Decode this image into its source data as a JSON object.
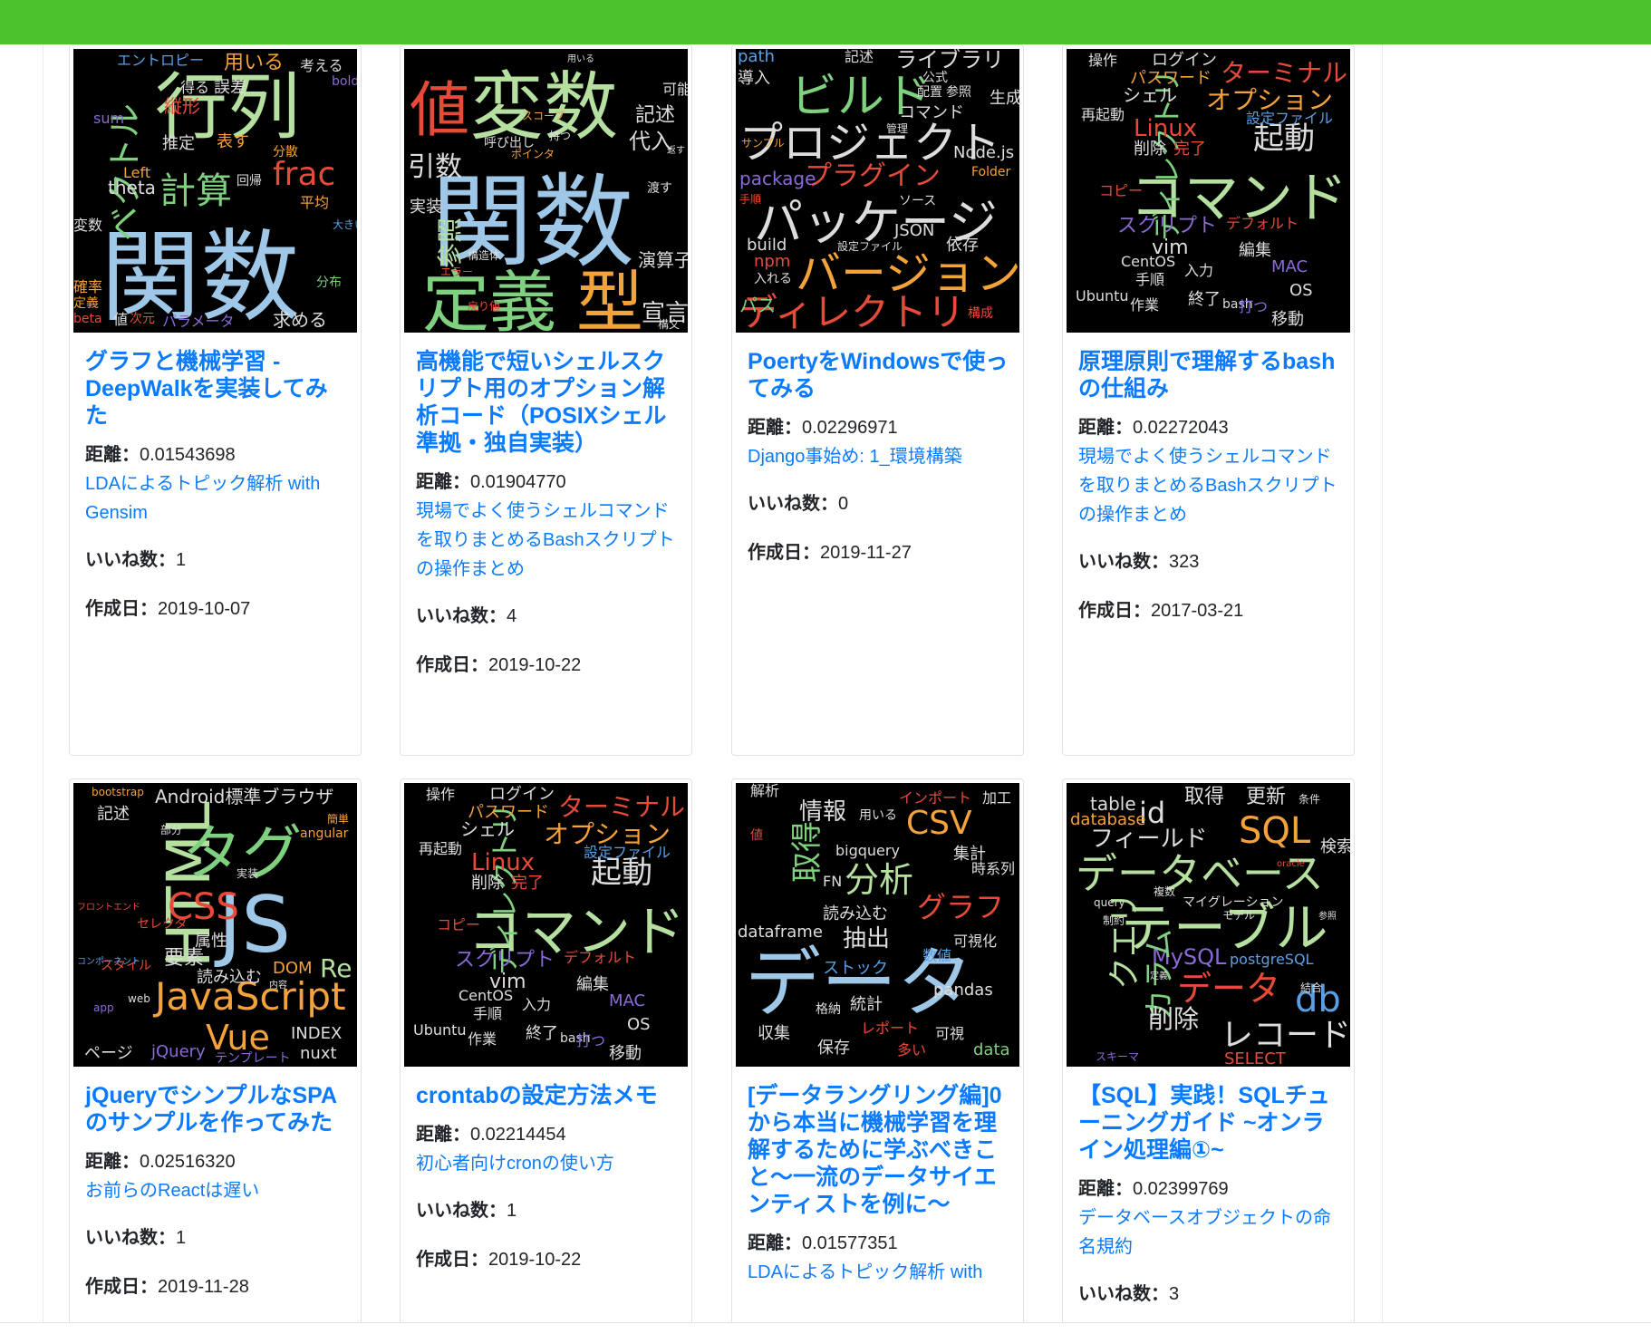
{
  "labels": {
    "distance": "距離：",
    "likes": "いいね数：",
    "created": "作成日："
  },
  "colors": {
    "header": "#4cc32d",
    "link": "#0a7bff"
  },
  "cards": [
    {
      "title": "グラフと機械学習 - DeepWalkを実装してみた",
      "distance": "0.01543698",
      "related": "LDAによるトピック解析 with Gensim",
      "likes": "1",
      "created": "2019-10-07",
      "cloud_words": [
        "行列",
        "関数",
        "ベクトル",
        "計算",
        "frac",
        "推定",
        "表す",
        "用いる",
        "縦形",
        "エントロピー",
        "得る",
        "誤差",
        "sum",
        "theta",
        "Left",
        "回帰",
        "分散",
        "平均",
        "確率",
        "変数",
        "分布",
        "大きい",
        "定義",
        "beta",
        "値",
        "次元",
        "パラメータ",
        "求める",
        "考える",
        "boldsymbol"
      ]
    },
    {
      "title": "高機能で短いシェルスクリプト用のオプション解析コード（POSIXシェル準拠・独自実装）",
      "distance": "0.01904770",
      "related": "現場でよく使うシェルコマンドを取りまとめるBashスクリプトの操作まとめ",
      "likes": "4",
      "created": "2019-10-22",
      "cloud_words": [
        "変数",
        "関数",
        "値",
        "定義",
        "型",
        "引数",
        "参照",
        "宣言",
        "記述",
        "代入",
        "可能",
        "演算子",
        "呼び出し",
        "スコープ",
        "ポインタ",
        "実装",
        "構造体",
        "戻り値",
        "エラー",
        "渡す",
        "持つ",
        "構文",
        "用いる",
        "返す"
      ]
    },
    {
      "title": "PoertyをWindowsで使ってみる",
      "distance": "0.02296971",
      "related": "Django事始め: 1_環境構築",
      "likes": null,
      "created": "2019-11-27",
      "cloud_words": [
        "ビルド",
        "プロジェクト",
        "パッケージ",
        "バージョン",
        "ディレクトリ",
        "ライブラリ",
        "プラグイン",
        "package",
        "path",
        "導入",
        "記述",
        "公式",
        "コマンド",
        "配置",
        "参照",
        "生成",
        "Node.js",
        "Folder",
        "サンプル",
        "JSON",
        "build",
        "npm",
        "依存",
        "設定ファイル",
        "ソース",
        "管理",
        "入れる",
        "パス",
        "手順",
        "構成"
      ]
    },
    {
      "title": "原理原則で理解するbashの仕組み",
      "distance": "0.02272043",
      "related": "現場でよく使うシェルコマンドを取りまとめるBashスクリプトの操作まとめ",
      "likes": "323",
      "created": "2017-03-21",
      "cloud_words": [
        "コマンド",
        "起動",
        "ターミナル",
        "オプション",
        "ディレクトリ",
        "Linux",
        "スクリプト",
        "デフォルト",
        "ログイン",
        "操作",
        "パスワード",
        "シェル",
        "設定ファイル",
        "再起動",
        "削除",
        "完了",
        "コピー",
        "vim",
        "CentOS",
        "手順",
        "入力",
        "編集",
        "MAC",
        "OS",
        "Ubuntu",
        "作業",
        "終了",
        "bash",
        "打つ",
        "移動"
      ]
    },
    {
      "title": "jQueryでシンプルなSPAのサンプルを作ってみた",
      "distance": "0.02516320",
      "related": "お前らのReactは遅い",
      "likes": "1",
      "created": "2019-11-28",
      "cloud_words": [
        "HTML",
        "タグ",
        "JS",
        "CSS",
        "JavaScript",
        "Vue",
        "Re・Act",
        "Android標準ブラウザ",
        "bootstrap",
        "記述",
        "angular",
        "簡単",
        "部分",
        "要素",
        "属性",
        "読み込む",
        "DOM",
        "内容",
        "セレクタ",
        "スタイル",
        "コンポーネント",
        "フロントエンド",
        "web",
        "app",
        "ページ",
        "jQuery",
        "テンプレート",
        "INDEX",
        "nuxt",
        "実装"
      ]
    },
    {
      "title": "crontabの設定方法メモ",
      "distance": "0.02214454",
      "related": "初心者向けcronの使い方",
      "likes": "1",
      "created": "2019-10-22",
      "cloud_words": [
        "コマンド",
        "起動",
        "ターミナル",
        "オプション",
        "ディレクトリ",
        "Linux",
        "スクリプト",
        "デフォルト",
        "ログイン",
        "操作",
        "パスワード",
        "シェル",
        "設定ファイル",
        "再起動",
        "削除",
        "完了",
        "コピー",
        "vim",
        "CentOS",
        "手順",
        "入力",
        "編集",
        "MAC",
        "OS",
        "Ubuntu",
        "作業",
        "終了",
        "bash",
        "打つ",
        "移動"
      ]
    },
    {
      "title": "[データラングリング編]0から本当に機械学習を理解するために学ぶべきこと〜一流のデータサイエンティストを例に〜",
      "distance": "0.01577351",
      "related": "LDAによるトピック解析 with",
      "likes": null,
      "created": null,
      "cloud_words": [
        "データ",
        "分析",
        "CSV",
        "グラフ",
        "取得",
        "情報",
        "抽出",
        "解析",
        "インポート",
        "加工",
        "値",
        "用いる",
        "bigquery",
        "FN",
        "集計",
        "時系列",
        "読み込む",
        "dataframe",
        "可視化",
        "ストック",
        "数値",
        "統計",
        "pandas",
        "格納",
        "レポート",
        "収集",
        "保存",
        "多い",
        "可視",
        "data"
      ]
    },
    {
      "title": "【SQL】実践！SQLチューニングガイド ~オンライン処理編①~",
      "distance": "0.02399769",
      "related": "データベースオブジェクトの命名規約",
      "likes": "3",
      "created": null,
      "cloud_words": [
        "データベース",
        "テーブル",
        "SQL",
        "id",
        "フィールド",
        "取得",
        "更新",
        "table",
        "database",
        "条件",
        "検索",
        "oracle",
        "query",
        "複数",
        "マイグレーション",
        "モデル",
        "参照",
        "制約",
        "MySQL",
        "postgreSQL",
        "クエリ",
        "カラム",
        "削除",
        "データ",
        "db",
        "レコード",
        "SELECT",
        "スキーマ",
        "結合",
        "定義"
      ]
    }
  ]
}
